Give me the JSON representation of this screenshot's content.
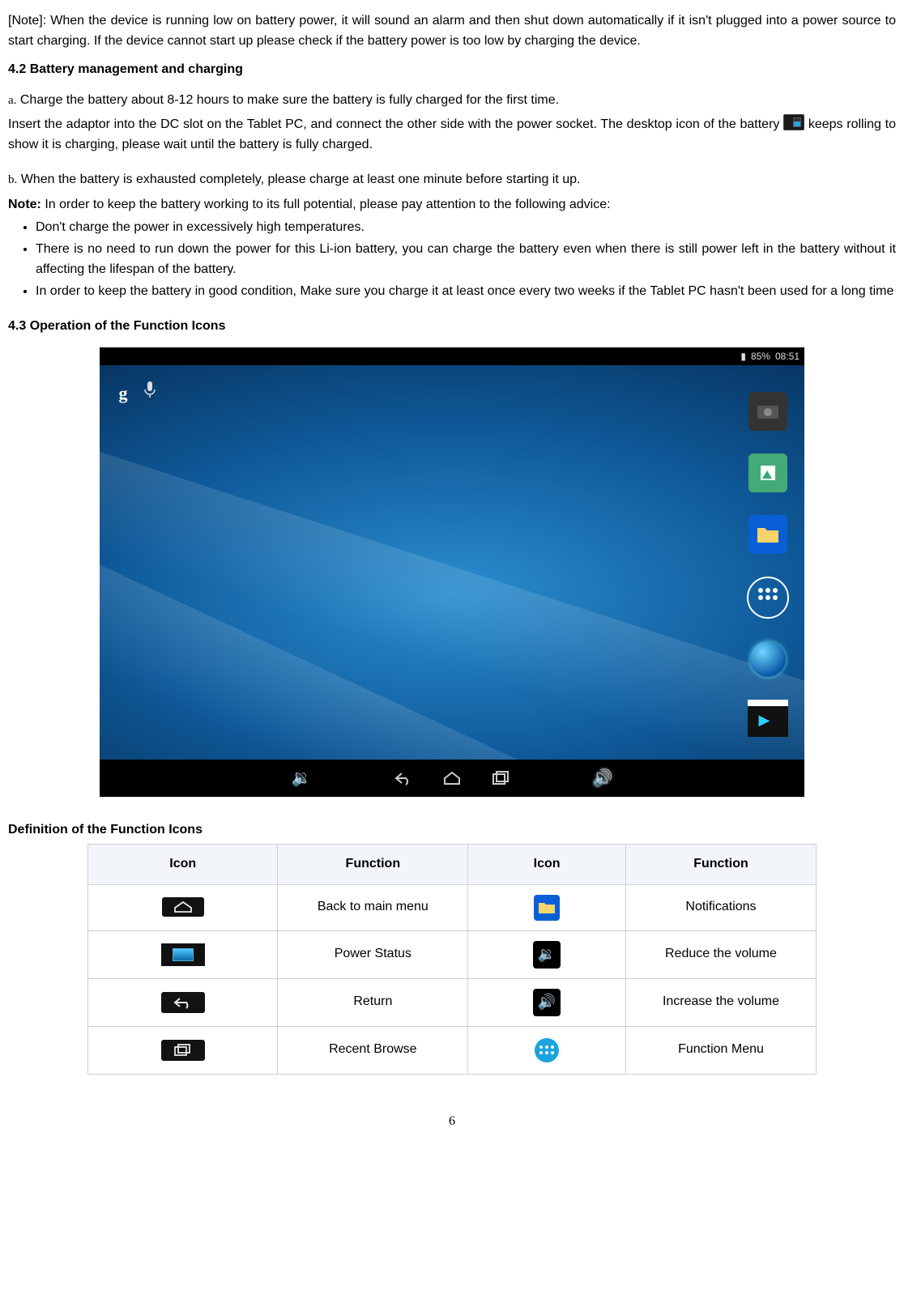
{
  "note_paragraph": "[Note]: When the device is running low on battery power, it will sound an alarm and then shut down automatically if it isn't plugged into a power source to start charging. If the device cannot start up please check if the battery power is too low by charging the device.",
  "sec42_heading": "4.2 Battery management and charging",
  "item_a_letter": "a.",
  "item_a_text": "Charge the battery about 8-12 hours to make sure the battery is fully charged for the first time.",
  "insert_text_1": "Insert the adaptor into the DC slot on the Tablet PC, and connect the other side with the power socket. The desktop icon of the battery ",
  "insert_text_2": " keeps rolling to show it is charging, please wait until the battery is fully charged.",
  "item_b_letter": "b.",
  "item_b_text": "When the battery is exhausted completely, please charge at least one minute before starting it up.",
  "note_label": "Note:",
  "note_intro": " In order to keep the battery working to its full potential, please pay attention to the following advice:",
  "bullet1": "Don't charge the power in excessively high temperatures.",
  "bullet2": "There is no need to run down the power for this Li-ion battery, you can charge the battery even when there is still power left in the battery without it affecting the lifespan of the battery.",
  "bullet3": "In order to keep the battery in good condition, Make sure you charge it at least once every two weeks if the Tablet PC hasn't been used for a long time",
  "sec43_heading": "4.3 Operation of the Function Icons",
  "screenshot": {
    "battery_pct": "85%",
    "clock": "08:51",
    "google_g": "g"
  },
  "def_heading": "Definition of the Function Icons",
  "table": {
    "headers": [
      "Icon",
      "Function",
      "Icon",
      "Function"
    ],
    "rows": [
      {
        "f1": "Back to main menu",
        "f2": "Notifications"
      },
      {
        "f1": "Power Status",
        "f2": "Reduce the volume"
      },
      {
        "f1": "Return",
        "f2": "Increase the volume"
      },
      {
        "f1": "Recent Browse",
        "f2": "Function Menu"
      }
    ]
  },
  "page_number": "6"
}
